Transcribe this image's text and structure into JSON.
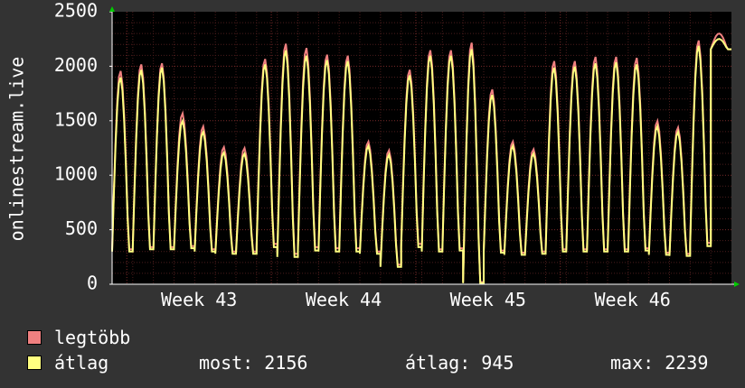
{
  "chart_data": {
    "type": "line",
    "ylabel": "onlinestream.live",
    "ylim": [
      0,
      2500
    ],
    "yticks": [
      0,
      500,
      1000,
      1500,
      2000,
      2500
    ],
    "xticks": [
      "Week 43",
      "Week 44",
      "Week 45",
      "Week 46"
    ],
    "grid": true,
    "legend_placement": "bottom-left",
    "colors": {
      "legtobb": "#f08080",
      "atlag": "#ffff80",
      "background": "#333333",
      "plot_bg": "#000000",
      "grid": "#5a1f1f",
      "axis": "#ffffff"
    },
    "days": 30,
    "series": [
      {
        "name": "legtöbb",
        "peaks": [
          1960,
          2020,
          2030,
          1570,
          1450,
          1260,
          1250,
          2070,
          2210,
          2170,
          2110,
          2100,
          1310,
          1230,
          1970,
          2150,
          2150,
          2220,
          1790,
          1310,
          1240,
          2050,
          2050,
          2090,
          2090,
          2080,
          1500,
          1440,
          2240,
          2300
        ],
        "troughs": [
          320,
          340,
          340,
          350,
          320,
          300,
          300,
          370,
          280,
          340,
          330,
          330,
          300,
          180,
          370,
          320,
          330,
          20,
          310,
          290,
          300,
          320,
          320,
          320,
          320,
          330,
          290,
          280,
          380,
          2156
        ]
      },
      {
        "name": "átlag",
        "peaks": [
          1900,
          1970,
          1990,
          1500,
          1400,
          1210,
          1200,
          2020,
          2150,
          2100,
          2060,
          2050,
          1270,
          1190,
          1920,
          2100,
          2100,
          2160,
          1740,
          1270,
          1200,
          1990,
          2000,
          2030,
          2040,
          2020,
          1450,
          1400,
          2190,
          2250
        ],
        "troughs": [
          300,
          320,
          320,
          330,
          300,
          280,
          280,
          340,
          250,
          310,
          300,
          300,
          280,
          160,
          340,
          300,
          310,
          10,
          290,
          270,
          280,
          300,
          300,
          300,
          300,
          310,
          270,
          260,
          350,
          2156
        ]
      }
    ]
  },
  "legend": {
    "items": [
      {
        "label": "legtöbb",
        "color": "#f08080"
      },
      {
        "label": "átlag",
        "color": "#ffff80"
      }
    ],
    "stats": {
      "current": "most: 2156",
      "average": "átlag: 945",
      "max": "max: 2239"
    }
  }
}
